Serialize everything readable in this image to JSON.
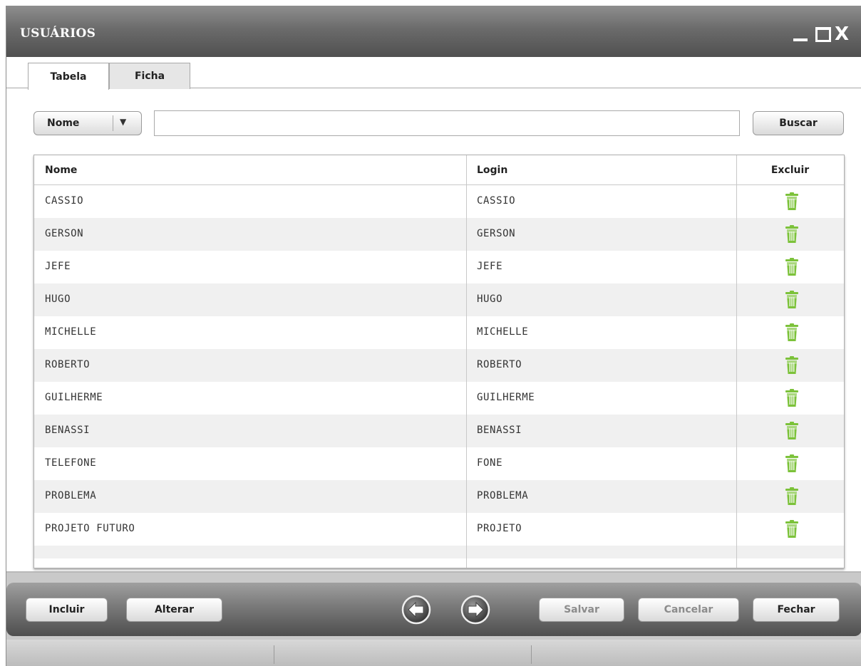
{
  "window": {
    "title": "USUÁRIOS",
    "minimize_label": "_",
    "maximize_label": "☐",
    "close_label": "X"
  },
  "tabs": [
    {
      "label": "Tabela",
      "active": true
    },
    {
      "label": "Ficha",
      "active": false
    }
  ],
  "filter": {
    "field_selected": "Nome",
    "search_value": "",
    "search_button": "Buscar"
  },
  "table": {
    "columns": [
      "Nome",
      "Login",
      "Excluir"
    ],
    "rows": [
      {
        "nome": "CASSIO",
        "login": "CASSIO"
      },
      {
        "nome": "GERSON",
        "login": "GERSON"
      },
      {
        "nome": "JEFE",
        "login": "JEFE"
      },
      {
        "nome": "HUGO",
        "login": "HUGO"
      },
      {
        "nome": "MICHELLE",
        "login": "MICHELLE"
      },
      {
        "nome": "ROBERTO",
        "login": "ROBERTO"
      },
      {
        "nome": "GUILHERME",
        "login": "GUILHERME"
      },
      {
        "nome": "BENASSI",
        "login": "BENASSI"
      },
      {
        "nome": "TELEFONE",
        "login": "FONE"
      },
      {
        "nome": "PROBLEMA",
        "login": "PROBLEMA"
      },
      {
        "nome": "PROJETO FUTURO",
        "login": "PROJETO"
      }
    ],
    "delete_icon": "trash-icon",
    "delete_icon_color": "#7cc23a"
  },
  "footer": {
    "incluir": "Incluir",
    "alterar": "Alterar",
    "salvar": "Salvar",
    "cancelar": "Cancelar",
    "fechar": "Fechar",
    "prev_icon": "arrow-left-icon",
    "next_icon": "arrow-right-icon"
  },
  "colors": {
    "titlebar": "#6b6b6b",
    "accent_green": "#7cc23a",
    "disabled_text": "#8c8c8c"
  }
}
